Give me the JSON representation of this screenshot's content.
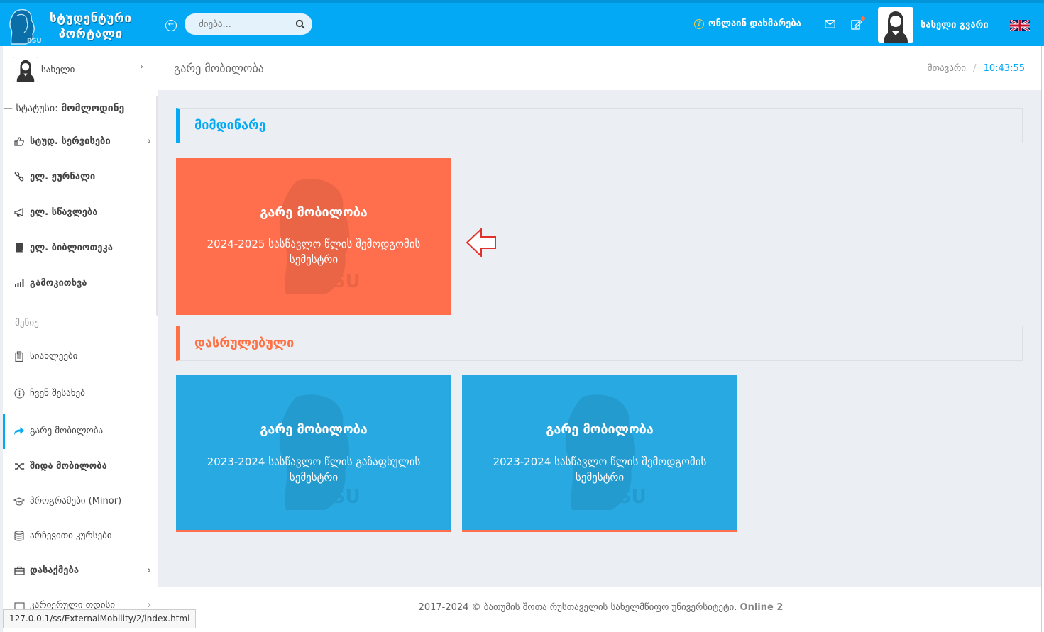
{
  "header": {
    "logo_line1": "სტუდენტური",
    "logo_line2": "პორტალი",
    "search_placeholder": "ძიება...",
    "help_label": "ონლაინ დახმარება",
    "user_name": "სახელი გვარი"
  },
  "sidebar": {
    "user_name": "სახელი",
    "status_label": "— სტატუსი:",
    "status_value": "მომლოდინე",
    "items": [
      {
        "label": "სტუდ. სერვისები",
        "icon": "thumbs-up-icon"
      },
      {
        "label": "ელ. ჟურნალი",
        "icon": "link-icon"
      },
      {
        "label": "ელ. სწავლება",
        "icon": "megaphone-icon"
      },
      {
        "label": "ელ. ბიბლიოთეკა",
        "icon": "book-icon"
      },
      {
        "label": "გამოკითხვა",
        "icon": "bar-chart-icon"
      }
    ],
    "menu_label": "— მენიუ —",
    "menu_items": [
      {
        "label": "სიახლეები",
        "icon": "clipboard-icon"
      },
      {
        "label": "ჩვენ შესახებ",
        "icon": "info-icon"
      },
      {
        "label": "გარე მობილობა",
        "icon": "share-icon"
      },
      {
        "label": "შიდა მობილობა",
        "icon": "shuffle-icon"
      },
      {
        "label": "პროგრამები (Minor)",
        "icon": "graduation-cap-icon"
      },
      {
        "label": "არჩევითი კურსები",
        "icon": "database-icon"
      },
      {
        "label": "დასაქმება",
        "icon": "briefcase-icon"
      },
      {
        "label": "კარიერული თდისი",
        "icon": "career-icon"
      }
    ]
  },
  "page": {
    "title": "გარე მობილობა",
    "breadcrumb_home": "მთავარი",
    "breadcrumb_sep": "/",
    "time": "10:43:55"
  },
  "sections": {
    "current": "მიმდინარე",
    "completed": "დასრულებული"
  },
  "cards": {
    "current": [
      {
        "title": "გარე მობილობა",
        "subtitle": "2024-2025 სასწავლო წლის შემოდგომის სემესტრი"
      }
    ],
    "completed": [
      {
        "title": "გარე მობილობა",
        "subtitle": "2023-2024 სასწავლო წლის გაზაფხულის სემესტრი"
      },
      {
        "title": "გარე მობილობა",
        "subtitle": "2023-2024 სასწავლო წლის შემოდგომის სემესტრი"
      }
    ]
  },
  "footer": {
    "text": "2017-2024 © ბათუმის შოთა რუსთაველის სახელმწიფო უნივერსიტეტი.",
    "online": "Online 2"
  },
  "statusbar": {
    "url": "127.0.0.1/ss/ExternalMobility/2/index.html"
  },
  "colors": {
    "primary": "#03a9f4",
    "accent": "#ff7043",
    "card_orange": "#ff6e4d",
    "card_blue": "#28a9e2"
  }
}
